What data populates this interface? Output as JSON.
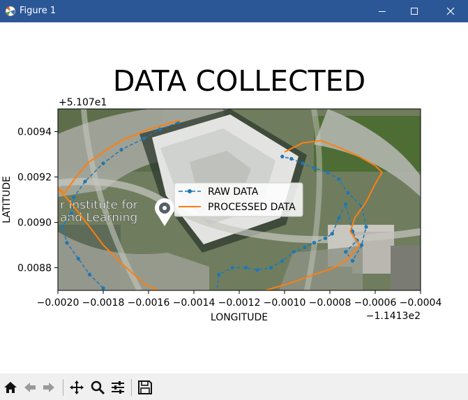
{
  "window": {
    "title": "Figure 1",
    "titlebar_color": "#2b5797",
    "controls": [
      "minimize-icon",
      "maximize-icon",
      "close-icon"
    ]
  },
  "chart_data": {
    "type": "line",
    "title": "DATA COLLECTED",
    "xlabel": "LONGITUDE",
    "ylabel": "LATITUDE",
    "x_offset_label": "−1.1413e2",
    "y_offset_label": "+5.107e1",
    "xlim": [
      -0.002,
      -0.0004
    ],
    "ylim": [
      0.0087,
      0.0095
    ],
    "xticks": [
      -0.002,
      -0.0018,
      -0.0016,
      -0.0014,
      -0.0012,
      -0.001,
      -0.0008,
      -0.0006,
      -0.0004
    ],
    "xtick_labels": [
      "−0.0020",
      "−0.0018",
      "−0.0016",
      "−0.0014",
      "−0.0012",
      "−0.0010",
      "−0.0008",
      "−0.0006",
      "−0.0004"
    ],
    "yticks": [
      0.0088,
      0.009,
      0.0092,
      0.0094
    ],
    "ytick_labels": [
      "0.0088",
      "0.0090",
      "0.0092",
      "0.0094"
    ],
    "grid": false,
    "legend_position": "center",
    "background": "aerial satellite image of a campus building",
    "overlay_text": [
      "r Institute for",
      "and Learning"
    ],
    "series": [
      {
        "name": "RAW DATA",
        "color": "#1f77b4",
        "style": "dashed line with circle markers",
        "x": [
          -0.00147,
          -0.00155,
          -0.00162,
          -0.00172,
          -0.0018,
          -0.00188,
          -0.00193,
          -0.00194,
          -0.00198,
          -0.00196,
          -0.00191,
          -0.00186,
          -0.0018,
          -0.00176,
          -0.0017,
          -0.00165,
          -0.00159,
          -0.00153,
          -0.00147,
          -0.00141,
          -0.00135,
          -0.00129,
          -0.00123,
          -0.00117,
          -0.00112,
          -0.00106,
          -0.00101,
          -0.00096,
          -0.00091,
          -0.00087,
          -0.00082,
          -0.00079,
          -0.00076,
          -0.00073,
          -0.0007,
          -0.00068,
          -0.00073,
          -0.0007,
          -0.00066,
          -0.00064,
          -0.00066,
          -0.00072,
          -0.00076,
          -0.00081,
          -0.00087,
          -0.00092,
          -0.00097,
          -0.00101
        ],
        "y": [
          0.00944,
          0.00941,
          0.00937,
          0.00932,
          0.00926,
          0.00918,
          0.00911,
          0.00904,
          0.00898,
          0.00891,
          0.00884,
          0.00877,
          0.00871,
          0.00865,
          0.0086,
          0.00853,
          0.00846,
          0.00839,
          0.00832,
          0.00828,
          0.00829,
          0.00877,
          0.0088,
          0.0088,
          0.00879,
          0.0088,
          0.00883,
          0.00887,
          0.00889,
          0.00891,
          0.00893,
          0.00895,
          0.00902,
          0.00908,
          0.00896,
          0.00892,
          0.00887,
          0.00883,
          0.0089,
          0.00898,
          0.00907,
          0.00913,
          0.00919,
          0.00922,
          0.00924,
          0.00926,
          0.00928,
          0.00929
        ]
      },
      {
        "name": "PROCESSED DATA",
        "color": "#ff7f0e",
        "style": "solid line",
        "x": [
          -0.00146,
          -0.0016,
          -0.00172,
          -0.0018,
          -0.00187,
          -0.00192,
          -0.00197,
          -0.002,
          -0.00193,
          -0.00186,
          -0.0018,
          -0.00172,
          -0.00162,
          -0.0015,
          -0.00138,
          -0.00126,
          -0.00115,
          -0.00105,
          -0.00095,
          -0.00087,
          -0.00078,
          -0.00072,
          -0.00067,
          -0.00071,
          -0.00069,
          -0.00064,
          -0.0006,
          -0.00057,
          -0.0006,
          -0.00067,
          -0.00076,
          -0.00084,
          -0.00092,
          -0.001
        ],
        "y": [
          0.00945,
          0.00941,
          0.00936,
          0.00931,
          0.00926,
          0.0092,
          0.00913,
          0.00915,
          0.00907,
          0.00898,
          0.0089,
          0.00882,
          0.00873,
          0.00867,
          0.00864,
          0.00865,
          0.00868,
          0.00871,
          0.00874,
          0.00877,
          0.0088,
          0.00884,
          0.0089,
          0.00896,
          0.00902,
          0.00909,
          0.00917,
          0.00922,
          0.00925,
          0.00929,
          0.00933,
          0.00936,
          0.00935,
          0.00931
        ]
      }
    ]
  },
  "toolbar": {
    "buttons": [
      "home-icon",
      "back-icon",
      "forward-icon",
      "pan-icon",
      "zoom-icon",
      "configure-subplots-icon",
      "save-icon"
    ]
  }
}
